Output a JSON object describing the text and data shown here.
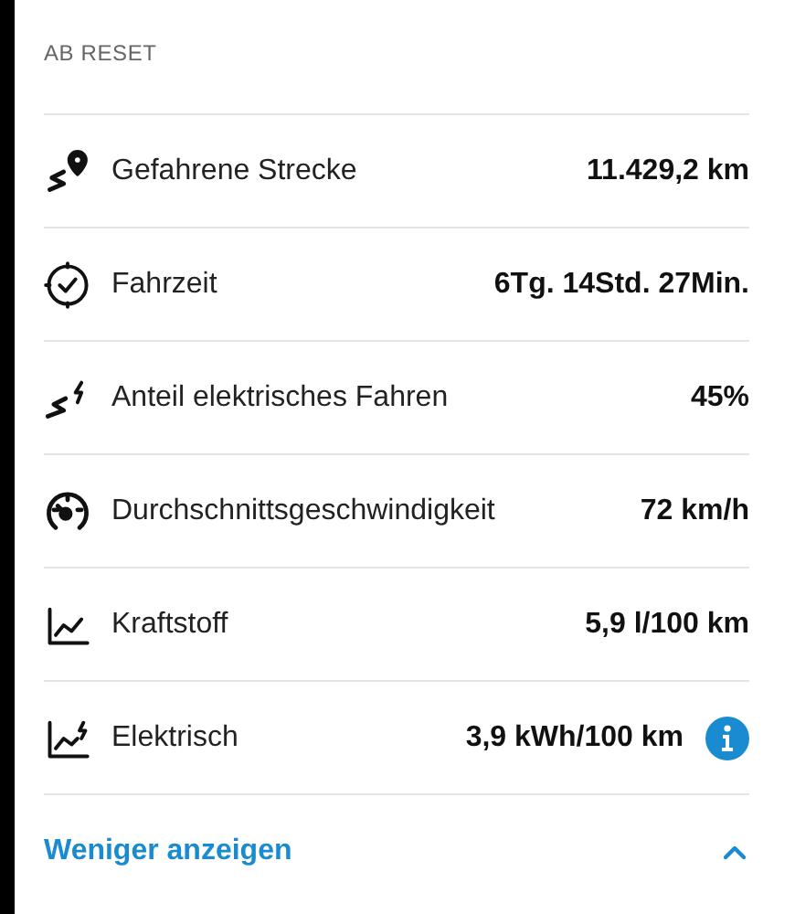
{
  "section_title": "AB RESET",
  "rows": [
    {
      "label": "Gefahrene Strecke",
      "value": "11.429,2 km",
      "info": false
    },
    {
      "label": "Fahrzeit",
      "value": "6Tg. 14Std. 27Min.",
      "info": false
    },
    {
      "label": "Anteil elektrisches Fahren",
      "value": "45%",
      "info": false
    },
    {
      "label": "Durchschnittsgeschwindigkeit",
      "value": "72 km/h",
      "info": false
    },
    {
      "label": "Kraftstoff",
      "value": "5,9 l/100 km",
      "info": false
    },
    {
      "label": "Elektrisch",
      "value": "3,9 kWh/100 km",
      "info": true
    }
  ],
  "toggle": {
    "label": "Weniger anzeigen",
    "expanded": true
  }
}
